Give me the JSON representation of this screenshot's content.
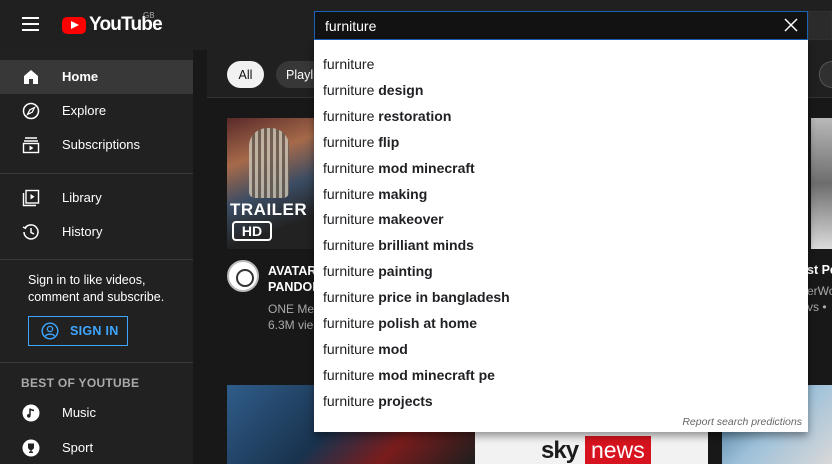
{
  "header": {
    "logo_text": "YouTube",
    "region": "GB",
    "search_value": "furniture",
    "menu_icon": "hamburger-menu-icon",
    "clear_icon": "close-icon"
  },
  "sidebar": {
    "items": [
      {
        "label": "Home",
        "icon": "home-icon",
        "active": true
      },
      {
        "label": "Explore",
        "icon": "compass-icon"
      },
      {
        "label": "Subscriptions",
        "icon": "subscriptions-icon"
      },
      {
        "label": "Library",
        "icon": "library-icon"
      },
      {
        "label": "History",
        "icon": "history-icon"
      }
    ],
    "signin_prompt": "Sign in to like videos, comment and subscribe.",
    "signin_button": "SIGN IN",
    "best_of_title": "BEST OF YOUTUBE",
    "best_of_items": [
      {
        "label": "Music",
        "icon": "music-note-icon"
      },
      {
        "label": "Sport",
        "icon": "trophy-icon"
      }
    ]
  },
  "chips": {
    "all": "All",
    "second": "Playl"
  },
  "suggestions": {
    "items": [
      {
        "prefix": "furniture",
        "rest": ""
      },
      {
        "prefix": "furniture",
        "rest": " design"
      },
      {
        "prefix": "furniture",
        "rest": " restoration"
      },
      {
        "prefix": "furniture",
        "rest": " flip"
      },
      {
        "prefix": "furniture",
        "rest": " mod minecraft"
      },
      {
        "prefix": "furniture",
        "rest": " making"
      },
      {
        "prefix": "furniture",
        "rest": " makeover"
      },
      {
        "prefix": "furniture",
        "rest": " brilliant minds"
      },
      {
        "prefix": "furniture",
        "rest": " painting"
      },
      {
        "prefix": "furniture",
        "rest": " price in bangladesh"
      },
      {
        "prefix": "furniture",
        "rest": " polish at home"
      },
      {
        "prefix": "furniture",
        "rest": " mod"
      },
      {
        "prefix": "furniture",
        "rest": " mod minecraft pe"
      },
      {
        "prefix": "furniture",
        "rest": " projects"
      }
    ],
    "report": "Report search predictions"
  },
  "videos": {
    "card1": {
      "badge_text": "TRAILER",
      "hd_text": "HD",
      "title_line1": "AVATAR",
      "title_line2": "PANDOR",
      "channel": "ONE Me",
      "views": "6.3M vie"
    },
    "card2": {
      "title": "st Pe",
      "channel": "erWo",
      "views": "vs •"
    },
    "sky": {
      "sky_text": "sky",
      "news_text": "news"
    }
  },
  "colors": {
    "accent_blue": "#3ea6ff",
    "search_border": "#1c62b9",
    "brand_red": "#ff0000",
    "news_red": "#d6131e"
  }
}
